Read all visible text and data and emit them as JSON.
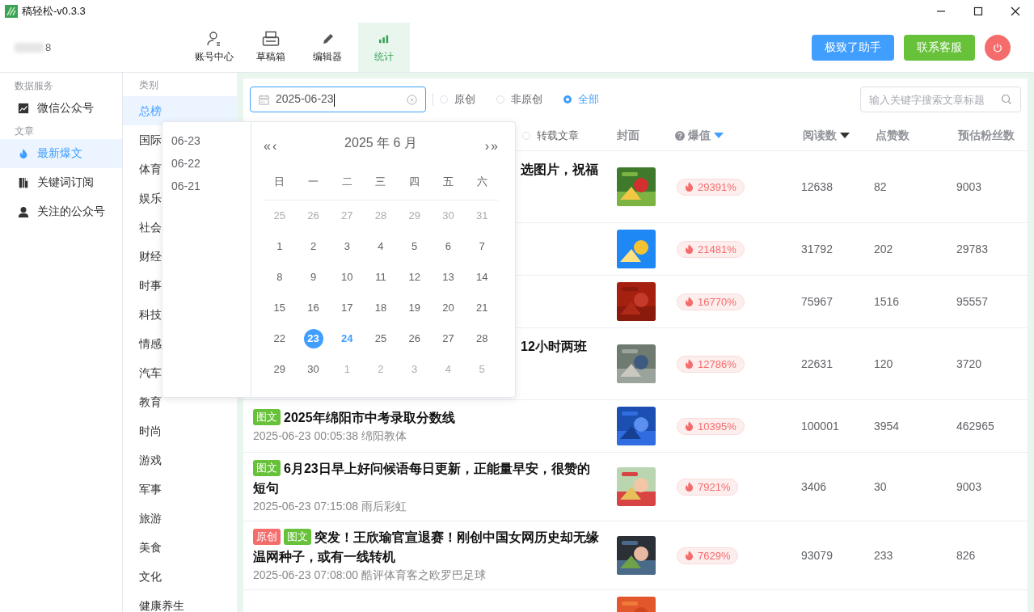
{
  "window": {
    "title": "稿轻松-v0.3.3"
  },
  "user": {
    "name": "8"
  },
  "nav": [
    {
      "label": "账号中心",
      "selected": false
    },
    {
      "label": "草稿箱",
      "selected": false
    },
    {
      "label": "编辑器",
      "selected": false
    },
    {
      "label": "统计",
      "selected": true
    }
  ],
  "header_buttons": [
    {
      "label": "极致了助手",
      "kind": "primary"
    },
    {
      "label": "联系客服",
      "kind": "success"
    }
  ],
  "sidebar": {
    "sections": [
      {
        "title": "数据服务",
        "items": [
          {
            "label": "微信公众号",
            "selected": false
          }
        ]
      },
      {
        "title": "文章",
        "items": [
          {
            "label": "最新爆文",
            "selected": true
          },
          {
            "label": "关键词订阅",
            "selected": false
          },
          {
            "label": "关注的公众号",
            "selected": false
          }
        ]
      }
    ]
  },
  "categories": {
    "title": "类别",
    "items": [
      {
        "label": "总榜",
        "selected": true
      },
      {
        "label": "国际",
        "selected": false
      },
      {
        "label": "体育",
        "selected": false
      },
      {
        "label": "娱乐",
        "selected": false
      },
      {
        "label": "社会",
        "selected": false
      },
      {
        "label": "财经",
        "selected": false
      },
      {
        "label": "时事",
        "selected": false
      },
      {
        "label": "科技",
        "selected": false
      },
      {
        "label": "情感",
        "selected": false
      },
      {
        "label": "汽车",
        "selected": false
      },
      {
        "label": "教育",
        "selected": false
      },
      {
        "label": "时尚",
        "selected": false
      },
      {
        "label": "游戏",
        "selected": false
      },
      {
        "label": "军事",
        "selected": false
      },
      {
        "label": "旅游",
        "selected": false
      },
      {
        "label": "美食",
        "selected": false
      },
      {
        "label": "文化",
        "selected": false
      },
      {
        "label": "健康养生",
        "selected": false
      }
    ]
  },
  "date_field": {
    "value": "2025-06-23"
  },
  "filters": [
    {
      "label": "原创",
      "selected": false
    },
    {
      "label": "非原创",
      "selected": false
    },
    {
      "label": "全部",
      "selected": true
    }
  ],
  "search": {
    "placeholder": "输入关键字搜索文章标题"
  },
  "table": {
    "title_header": {
      "radio": {
        "label": "转载文章",
        "selected": false
      }
    },
    "columns": [
      {
        "label": "封面",
        "kind": "plain"
      },
      {
        "label": "爆值",
        "kind": "hot"
      },
      {
        "label": "阅读数",
        "kind": "sorted"
      },
      {
        "label": "点赞数",
        "kind": "plain"
      },
      {
        "label": "预估粉丝数",
        "kind": "plain"
      }
    ],
    "rows": [
      {
        "kind": "covered",
        "title": "选图片，祝福",
        "hot": "29391%",
        "reads": "12638",
        "likes": "82",
        "fans": "9003"
      },
      {
        "kind": "hidden",
        "hot": "21481%",
        "reads": "31792",
        "likes": "202",
        "fans": "29783"
      },
      {
        "kind": "hidden",
        "hot": "16770%",
        "reads": "75967",
        "likes": "1516",
        "fans": "95557"
      },
      {
        "kind": "covered",
        "title": "12小时两班",
        "hot": "12786%",
        "reads": "22631",
        "likes": "120",
        "fans": "3720"
      },
      {
        "kind": "full",
        "tags": [
          {
            "label": "图文",
            "kind": "graphic"
          }
        ],
        "title": "2025年绵阳市中考录取分数线",
        "meta": "2025-06-23 00:05:38 绵阳教体",
        "hot": "10395%",
        "reads": "100001",
        "likes": "3954",
        "fans": "462965"
      },
      {
        "kind": "full",
        "tags": [
          {
            "label": "图文",
            "kind": "graphic"
          }
        ],
        "title": "6月23日早上好问候语每日更新，正能量早安，很赞的短句",
        "meta": "2025-06-23 07:15:08 雨后彩虹",
        "hot": "7921%",
        "reads": "3406",
        "likes": "30",
        "fans": "9003"
      },
      {
        "kind": "full",
        "tags": [
          {
            "label": "原创",
            "kind": "original"
          },
          {
            "label": "图文",
            "kind": "graphic"
          }
        ],
        "title": "突发！王欣瑜官宣退赛！刚创中国女网历史却无缘温网种子，或有一线转机",
        "meta": "2025-06-23 07:08:00 酷评体育客之欧罗巴足球",
        "hot": "7629%",
        "reads": "93079",
        "likes": "233",
        "fans": "826"
      },
      {
        "kind": "cut"
      }
    ]
  },
  "date_picker": {
    "shortcuts": [
      "06-23",
      "06-22",
      "06-21"
    ],
    "prev_year": "«",
    "prev_month": "‹",
    "title": "2025 年  6 月",
    "next_month": "›",
    "next_year": "»",
    "weekdays": [
      "日",
      "一",
      "二",
      "三",
      "四",
      "五",
      "六"
    ],
    "weeks": [
      [
        {
          "day": "25",
          "muted": true,
          "selected": false,
          "today": false
        },
        {
          "day": "26",
          "muted": true,
          "selected": false,
          "today": false
        },
        {
          "day": "27",
          "muted": true,
          "selected": false,
          "today": false
        },
        {
          "day": "28",
          "muted": true,
          "selected": false,
          "today": false
        },
        {
          "day": "29",
          "muted": true,
          "selected": false,
          "today": false
        },
        {
          "day": "30",
          "muted": true,
          "selected": false,
          "today": false
        },
        {
          "day": "31",
          "muted": true,
          "selected": false,
          "today": false
        }
      ],
      [
        {
          "day": "1",
          "muted": false,
          "selected": false,
          "today": false
        },
        {
          "day": "2",
          "muted": false,
          "selected": false,
          "today": false
        },
        {
          "day": "3",
          "muted": false,
          "selected": false,
          "today": false
        },
        {
          "day": "4",
          "muted": false,
          "selected": false,
          "today": false
        },
        {
          "day": "5",
          "muted": false,
          "selected": false,
          "today": false
        },
        {
          "day": "6",
          "muted": false,
          "selected": false,
          "today": false
        },
        {
          "day": "7",
          "muted": false,
          "selected": false,
          "today": false
        }
      ],
      [
        {
          "day": "8",
          "muted": false,
          "selected": false,
          "today": false
        },
        {
          "day": "9",
          "muted": false,
          "selected": false,
          "today": false
        },
        {
          "day": "10",
          "muted": false,
          "selected": false,
          "today": false
        },
        {
          "day": "11",
          "muted": false,
          "selected": false,
          "today": false
        },
        {
          "day": "12",
          "muted": false,
          "selected": false,
          "today": false
        },
        {
          "day": "13",
          "muted": false,
          "selected": false,
          "today": false
        },
        {
          "day": "14",
          "muted": false,
          "selected": false,
          "today": false
        }
      ],
      [
        {
          "day": "15",
          "muted": false,
          "selected": false,
          "today": false
        },
        {
          "day": "16",
          "muted": false,
          "selected": false,
          "today": false
        },
        {
          "day": "17",
          "muted": false,
          "selected": false,
          "today": false
        },
        {
          "day": "18",
          "muted": false,
          "selected": false,
          "today": false
        },
        {
          "day": "19",
          "muted": false,
          "selected": false,
          "today": false
        },
        {
          "day": "20",
          "muted": false,
          "selected": false,
          "today": false
        },
        {
          "day": "21",
          "muted": false,
          "selected": false,
          "today": false
        }
      ],
      [
        {
          "day": "22",
          "muted": false,
          "selected": false,
          "today": false
        },
        {
          "day": "23",
          "muted": false,
          "selected": true,
          "today": false
        },
        {
          "day": "24",
          "muted": false,
          "selected": false,
          "today": true
        },
        {
          "day": "25",
          "muted": false,
          "selected": false,
          "today": false
        },
        {
          "day": "26",
          "muted": false,
          "selected": false,
          "today": false
        },
        {
          "day": "27",
          "muted": false,
          "selected": false,
          "today": false
        },
        {
          "day": "28",
          "muted": false,
          "selected": false,
          "today": false
        }
      ],
      [
        {
          "day": "29",
          "muted": false,
          "selected": false,
          "today": false
        },
        {
          "day": "30",
          "muted": false,
          "selected": false,
          "today": false
        },
        {
          "day": "1",
          "muted": true,
          "selected": false,
          "today": false
        },
        {
          "day": "2",
          "muted": true,
          "selected": false,
          "today": false
        },
        {
          "day": "3",
          "muted": true,
          "selected": false,
          "today": false
        },
        {
          "day": "4",
          "muted": true,
          "selected": false,
          "today": false
        },
        {
          "day": "5",
          "muted": true,
          "selected": false,
          "today": false
        }
      ]
    ]
  }
}
